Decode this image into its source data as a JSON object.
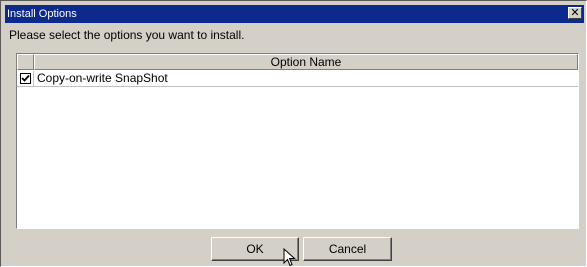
{
  "window": {
    "title": "Install Options",
    "close_glyph": "✕"
  },
  "prompt": "Please select the options you want to install.",
  "table": {
    "columns": [
      "",
      "Option Name"
    ],
    "rows": [
      {
        "checked": true,
        "name": "Copy-on-write SnapShot"
      }
    ]
  },
  "buttons": {
    "ok": "OK",
    "cancel": "Cancel"
  },
  "colors": {
    "titlebar": "#0b2a8c",
    "dialog_bg": "#d4d0c8"
  }
}
